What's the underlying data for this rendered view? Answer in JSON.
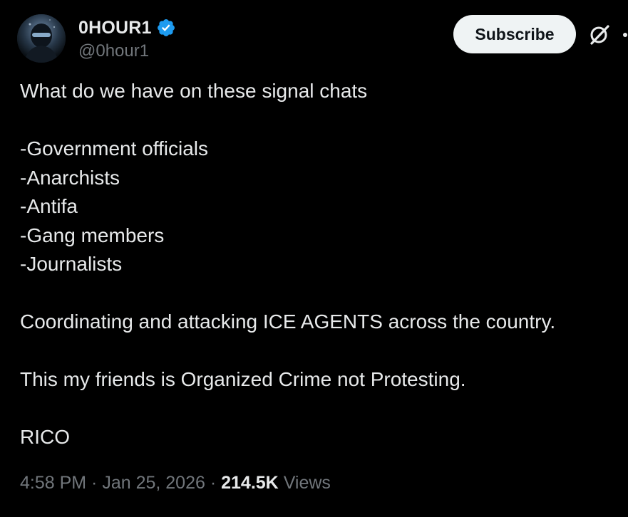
{
  "author": {
    "display_name": "0HOUR1",
    "handle": "@0hour1",
    "verified": true,
    "verified_color": "#1d9bf0"
  },
  "actions": {
    "subscribe_label": "Subscribe",
    "grok_icon": "grok-icon",
    "more_icon": "more-dots-icon"
  },
  "tweet": {
    "lines": [
      "What do we have on these signal chats",
      "",
      "-Government officials",
      "-Anarchists",
      "-Antifa",
      "-Gang members",
      "-Journalists",
      "",
      "Coordinating and attacking ICE AGENTS across the country.",
      "",
      "This my friends is Organized Crime not Protesting.",
      "",
      "RICO"
    ]
  },
  "meta": {
    "time": "4:58 PM",
    "separator": " · ",
    "date": "Jan 25, 2026",
    "views_count": "214.5K",
    "views_label": " Views"
  },
  "colors": {
    "background": "#000000",
    "text_primary": "#e7e9ea",
    "text_secondary": "#71767b",
    "button_bg": "#eff3f4"
  }
}
